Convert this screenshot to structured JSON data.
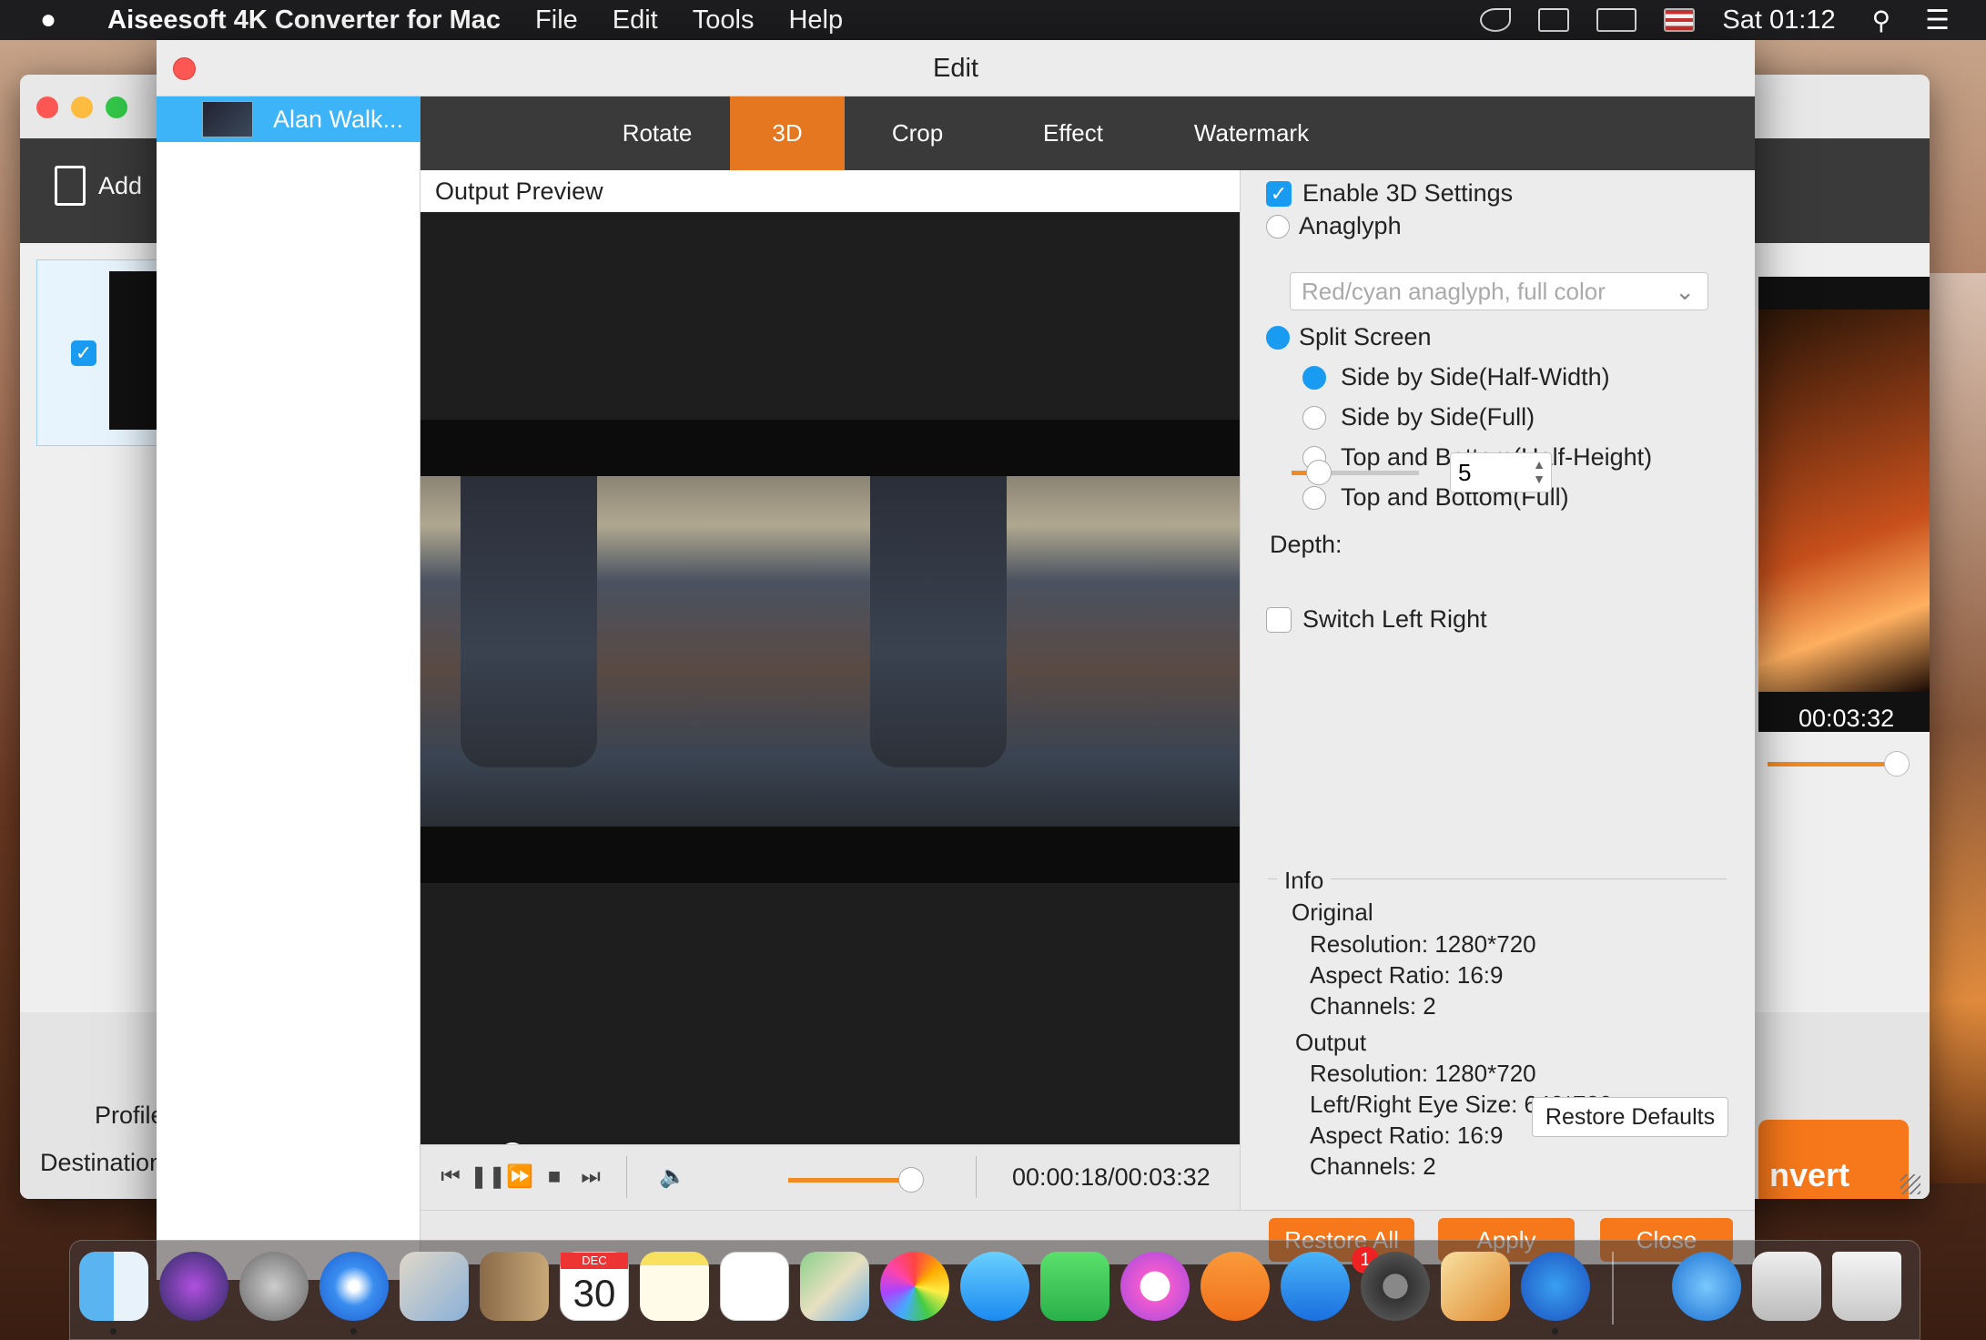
{
  "menubar": {
    "app_name": "Aiseesoft 4K Converter for Mac",
    "menus": [
      "File",
      "Edit",
      "Tools",
      "Help"
    ],
    "clock": "Sat 01:12"
  },
  "main_window": {
    "add_label": "Add",
    "duration": "00:03:32",
    "profile_label": "Profile",
    "destination_label": "Destination",
    "convert_label": "nvert"
  },
  "edit_dialog": {
    "title": "Edit",
    "sidebar_item": "Alan Walk...",
    "tabs": [
      "Rotate",
      "3D",
      "Crop",
      "Effect",
      "Watermark"
    ],
    "active_tab": "3D",
    "preview_label": "Output Preview",
    "time_display": "00:00:18/00:03:32",
    "seek_progress": 0.08,
    "volume_level": 0.9,
    "settings": {
      "enable_3d": "Enable 3D Settings",
      "anaglyph": "Anaglyph",
      "anaglyph_option": "Red/cyan anaglyph, full color",
      "split_screen": "Split Screen",
      "options": [
        "Side by Side(Half-Width)",
        "Side by Side(Full)",
        "Top and Bottom(Half-Height)",
        "Top and Bottom(Full)"
      ],
      "selected_option": "Side by Side(Half-Width)",
      "depth_label": "Depth:",
      "depth_value": "5",
      "switch_left_right": "Switch Left Right"
    },
    "info": {
      "legend": "Info",
      "original_label": "Original",
      "original": [
        "Resolution: 1280*720",
        "Aspect Ratio: 16:9",
        "Channels: 2"
      ],
      "output_label": "Output",
      "output": [
        "Resolution: 1280*720",
        "Left/Right Eye Size: 640*720",
        "Aspect Ratio: 16:9",
        "Channels: 2"
      ]
    },
    "restore_defaults": "Restore Defaults",
    "restore_all": "Restore All",
    "apply": "Apply",
    "close": "Close"
  },
  "dock": {
    "calendar_month": "DEC",
    "calendar_day": "30",
    "app_store_badge": "1",
    "icons": [
      "finder-icon",
      "siri-icon",
      "launchpad-icon",
      "safari-icon",
      "mail-icon",
      "contacts-icon",
      "calendar-icon",
      "notes-icon",
      "reminders-icon",
      "maps-icon",
      "photos-icon",
      "messages-icon",
      "facetime-icon",
      "itunes-icon",
      "ibooks-icon",
      "app-store-icon",
      "system-preferences-icon",
      "sketch-icon",
      "4k-converter-icon",
      "downloads-icon",
      "archive-icon",
      "trash-icon"
    ]
  }
}
